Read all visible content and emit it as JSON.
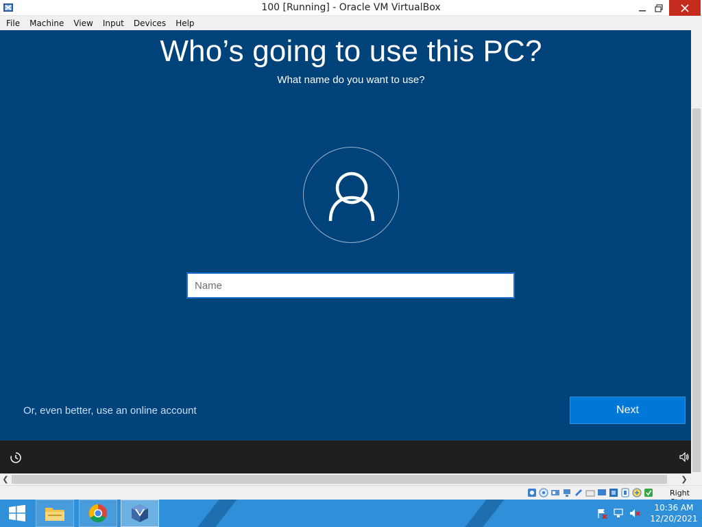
{
  "window": {
    "title": "100 [Running] - Oracle VM VirtualBox",
    "icon": "virtualbox-icon"
  },
  "menu": {
    "items": [
      "File",
      "Machine",
      "View",
      "Input",
      "Devices",
      "Help"
    ]
  },
  "oobe": {
    "title": "Who’s going to use this PC?",
    "subtitle": "What name do you want to use?",
    "avatar_icon": "user-icon",
    "name_placeholder": "Name",
    "name_value": "",
    "online_account_link": "Or, even better, use an online account",
    "next_label": "Next",
    "accent_color": "#0078d7",
    "background_color": "#00427a"
  },
  "footer": {
    "left_icon": "ease-of-access-icon",
    "right_icon": "volume-icon"
  },
  "statusbar": {
    "host_key": "Right Ctrl",
    "icons": [
      "hard-disk-icon",
      "optical-drive-icon",
      "audio-icon",
      "network-icon",
      "usb-icon",
      "shared-folders-icon",
      "display-icon",
      "video-capture-icon",
      "guest-additions-icon",
      "mouse-integration-icon",
      "keyboard-icon"
    ]
  },
  "taskbar": {
    "apps": [
      "file-explorer-icon",
      "chrome-icon",
      "virtualbox-icon"
    ],
    "tray_icons": [
      "action-center-flag-icon",
      "network-icon",
      "volume-muted-icon"
    ],
    "time": "10:36 AM",
    "date": "12/20/2021"
  }
}
